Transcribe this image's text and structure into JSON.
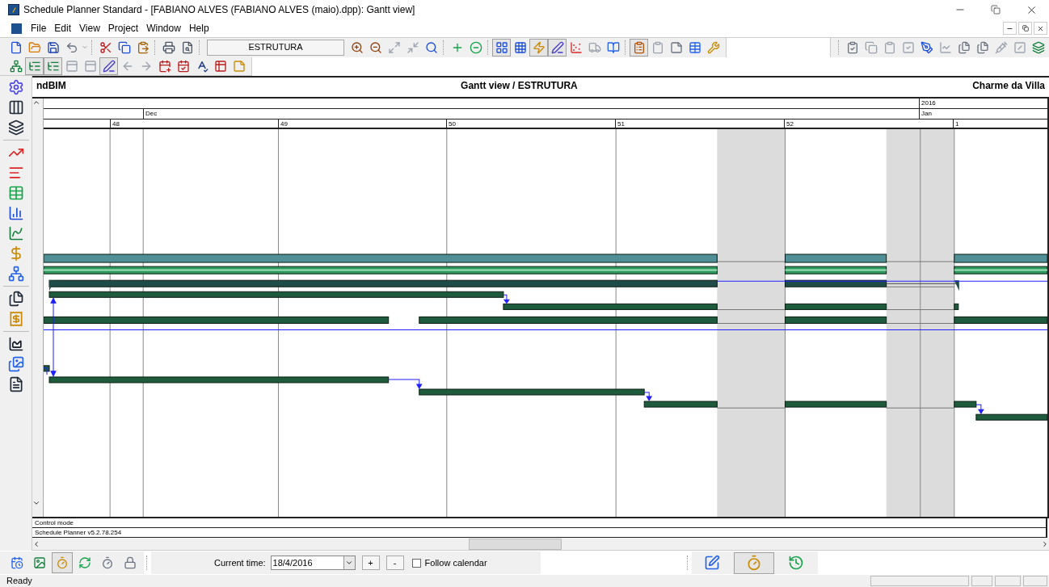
{
  "window": {
    "title": "Schedule Planner Standard - [FABIANO ALVES (FABIANO ALVES (maio).dpp): Gantt view]"
  },
  "menu": [
    "File",
    "Edit",
    "View",
    "Project",
    "Window",
    "Help"
  ],
  "toolbar_1": {
    "view_field": "ESTRUTURA",
    "left_buttons": [
      {
        "pressed": false
      },
      {
        "pressed": false
      },
      {
        "pressed": false
      },
      {
        "pressed": false
      },
      {
        "pressed": false
      },
      {
        "pressed": false
      },
      {
        "pressed": false
      },
      {
        "pressed": false
      },
      {
        "pressed": false
      },
      {
        "pressed": false
      }
    ],
    "mid_buttons": [
      {
        "pressed": false
      },
      {
        "pressed": false
      },
      {
        "pressed": false
      },
      {
        "pressed": false
      },
      {
        "pressed": false
      },
      {
        "pressed": false
      },
      {
        "pressed": false
      },
      {
        "pressed": true
      },
      {
        "pressed": false
      },
      {
        "pressed": true
      },
      {
        "pressed": true
      },
      {
        "pressed": false
      },
      {
        "pressed": false
      },
      {
        "pressed": false
      },
      {
        "pressed": true
      },
      {
        "pressed": false
      },
      {
        "pressed": false
      },
      {
        "pressed": false
      },
      {
        "pressed": false
      }
    ],
    "right_buttons": [
      {
        "pressed": false
      },
      {
        "pressed": false
      },
      {
        "pressed": false
      },
      {
        "pressed": false
      },
      {
        "pressed": false
      },
      {
        "pressed": false
      },
      {
        "pressed": false
      },
      {
        "pressed": false
      },
      {
        "pressed": false
      },
      {
        "pressed": false
      },
      {
        "pressed": false
      }
    ]
  },
  "toolbar_2": {
    "buttons": [
      {
        "pressed": false
      },
      {
        "pressed": true
      },
      {
        "pressed": true
      },
      {
        "pressed": false
      },
      {
        "pressed": false
      },
      {
        "pressed": true
      },
      {
        "pressed": false
      },
      {
        "pressed": false
      },
      {
        "pressed": false
      },
      {
        "pressed": false
      },
      {
        "pressed": false
      },
      {
        "pressed": false
      },
      {
        "pressed": false
      }
    ]
  },
  "side_toolbar": {
    "buttons": [
      {
        "pressed": false
      },
      {
        "pressed": false
      },
      {
        "pressed": false
      },
      {
        "pressed": false
      },
      {
        "pressed": false
      },
      {
        "pressed": false
      },
      {
        "pressed": false
      },
      {
        "pressed": false
      },
      {
        "pressed": false
      },
      {
        "pressed": false
      },
      {
        "pressed": false
      },
      {
        "pressed": false
      },
      {
        "pressed": false
      },
      {
        "pressed": false
      },
      {
        "pressed": false
      }
    ]
  },
  "gantt": {
    "header_left": "ndBIM",
    "header_center": "Gantt view / ESTRUTURA",
    "header_right": "Charme da Villa",
    "years": [
      "2016"
    ],
    "months": [
      "Dec",
      "Jan"
    ],
    "weeks": [
      "48",
      "49",
      "50",
      "51",
      "52",
      "1"
    ],
    "info_rows": [
      "Control mode",
      "Schedule Planner v5.2.78.254"
    ]
  },
  "bottom_toolbar": {
    "left_buttons": [
      {
        "pressed": false
      },
      {
        "pressed": false
      },
      {
        "pressed": true
      },
      {
        "pressed": false
      },
      {
        "pressed": false
      },
      {
        "pressed": false
      }
    ],
    "current_time_label": "Current time:",
    "current_time_value": "18/4/2016",
    "plus_button": "+",
    "minus_button": "-",
    "follow_calendar": {
      "label": "Follow calendar",
      "checked": false
    },
    "right_buttons": [
      {
        "pressed": false
      },
      {
        "pressed": true
      },
      {
        "pressed": false
      }
    ]
  },
  "status_bar": {
    "text": "Ready"
  }
}
